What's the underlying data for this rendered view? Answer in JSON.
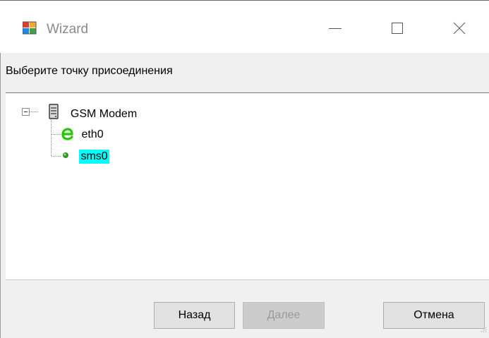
{
  "window": {
    "title": "Wizard",
    "icons": {
      "app": "wizard-app-icon",
      "minimize": "minimize-icon",
      "maximize": "maximize-icon",
      "close": "close-icon"
    }
  },
  "prompt": "Выберите точку присоединения",
  "tree": {
    "root": {
      "label": "GSM Modem",
      "icon": "server-icon",
      "expanded": true
    },
    "children": [
      {
        "label": "eth0",
        "icon": "ethernet-e-icon",
        "selected": false
      },
      {
        "label": "sms0",
        "icon": "green-dot-icon",
        "selected": true
      }
    ]
  },
  "buttons": {
    "back": "Назад",
    "next": "Далее",
    "cancel": "Отмена"
  },
  "colors": {
    "selection": "#00ffff",
    "ethernet_icon": "#27c400",
    "node_dot": "#2e9c1f"
  }
}
